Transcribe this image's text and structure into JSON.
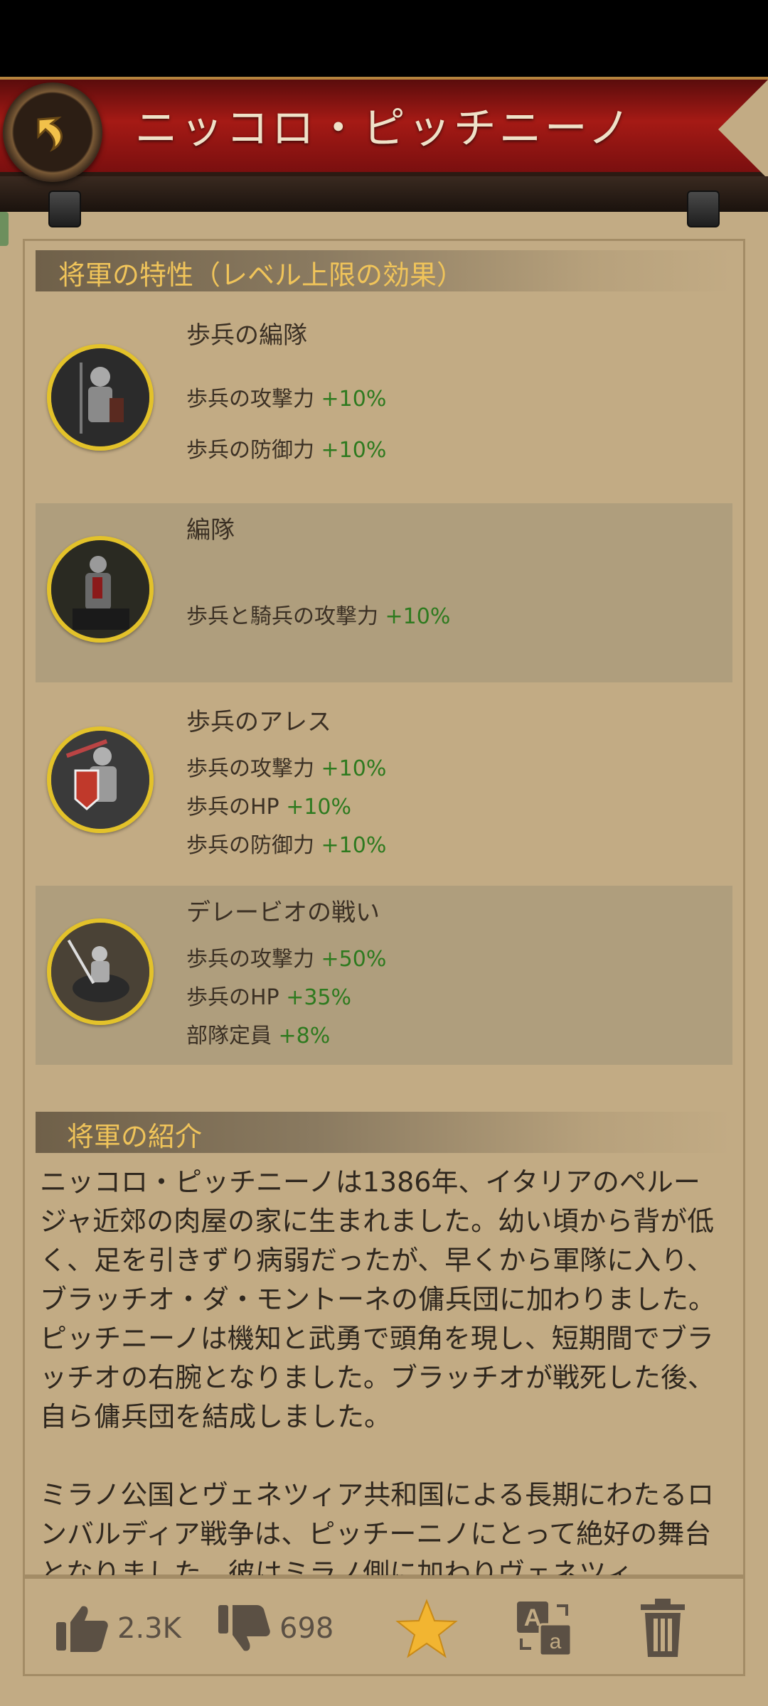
{
  "header": {
    "title": "ニッコロ・ピッチニーノ"
  },
  "traits_section": {
    "title": "将軍の特性（レベル上限の効果）"
  },
  "traits": [
    {
      "name": "歩兵の編隊",
      "bonuses": [
        {
          "label": "歩兵の攻撃力",
          "value": "+10%"
        },
        {
          "label": "歩兵の防御力",
          "value": "+10%"
        }
      ]
    },
    {
      "name": "編隊",
      "bonuses": [
        {
          "label": "歩兵と騎兵の攻撃力",
          "value": "+10%"
        }
      ]
    },
    {
      "name": "歩兵のアレス",
      "bonuses": [
        {
          "label": "歩兵の攻撃力",
          "value": "+10%"
        },
        {
          "label": "歩兵のHP",
          "value": "+10%"
        },
        {
          "label": "歩兵の防御力",
          "value": "+10%"
        }
      ]
    },
    {
      "name": "デレービオの戦い",
      "bonuses": [
        {
          "label": "歩兵の攻撃力",
          "value": "+50%"
        },
        {
          "label": "歩兵のHP",
          "value": "+35%"
        },
        {
          "label": "部隊定員",
          "value": "+8%"
        }
      ]
    }
  ],
  "intro_section": {
    "title": "将軍の紹介",
    "paragraphs": [
      "ニッコロ・ピッチニーノは1386年、イタリアのペルージャ近郊の肉屋の家に生まれました。幼い頃から背が低く、足を引きずり病弱だったが、早くから軍隊に入り、ブラッチオ・ダ・モントーネの傭兵団に加わりました。ピッチニーノは機知と武勇で頭角を現し、短期間でブラッチオの右腕となりました。ブラッチオが戦死した後、自ら傭兵団を結成しました。",
      "ミラノ公国とヴェネツィア共和国による長期にわたるロンバルディア戦争は、ピッチーニノにとって絶好の舞台となりました。彼はミラノ側に加わりヴェネツィ"
    ]
  },
  "actions": {
    "like_count": "2.3K",
    "dislike_count": "698"
  },
  "colors": {
    "accent_gold": "#f0c45a",
    "bonus_green": "#2e7a1f",
    "banner_red": "#a51a15",
    "star_yellow": "#f2b531"
  },
  "icons": [
    "back-arrow-icon",
    "thumbs-up-icon",
    "thumbs-down-icon",
    "star-icon",
    "translate-icon",
    "trash-icon"
  ]
}
